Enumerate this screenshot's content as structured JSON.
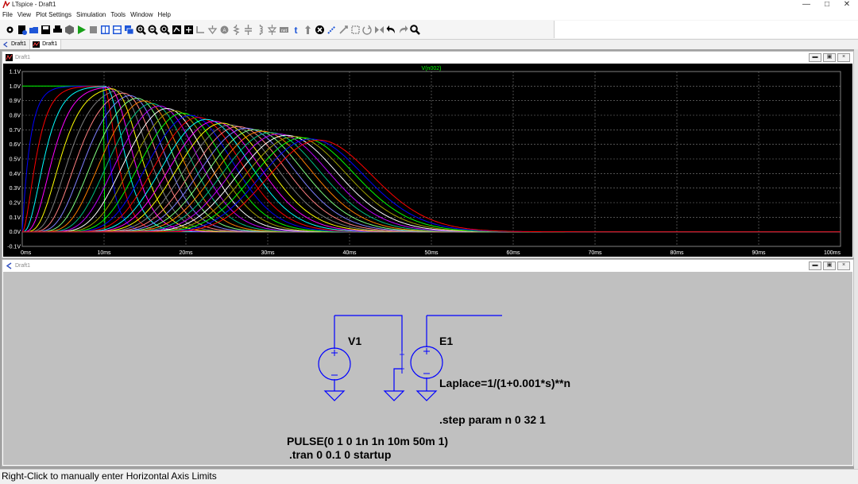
{
  "window": {
    "title": "LTspice - Draft1"
  },
  "menu": [
    "File",
    "View",
    "Plot Settings",
    "Simulation",
    "Tools",
    "Window",
    "Help"
  ],
  "toolbar_icons": [
    "settings-icon",
    "new-schematic-icon",
    "open-icon",
    "save-icon",
    "print-icon",
    "control-panel-icon",
    "run-icon",
    "halt-icon",
    "tile-horizontal-icon",
    "tile-vertical-icon",
    "cascade-icon",
    "zoom-in-icon",
    "zoom-out-icon",
    "zoom-full-icon",
    "autorange-icon",
    "pan-icon",
    "wire-icon",
    "ground-icon",
    "label-icon",
    "resistor-icon",
    "capacitor-icon",
    "inductor-icon",
    "diode-icon",
    "component-icon",
    "text-icon",
    "spice-directive-icon",
    "delete-icon",
    "duplicate-icon",
    "move-icon",
    "drag-icon",
    "rotate-icon",
    "mirror-icon",
    "undo-icon",
    "redo-icon",
    "find-icon"
  ],
  "tabs": [
    {
      "label": "Draft1",
      "kind": "schematic"
    },
    {
      "label": "Draft1",
      "kind": "waveform"
    }
  ],
  "waveform_window": {
    "title": "Draft1",
    "trace_label": "V(n002)"
  },
  "schematic_window": {
    "title": "Draft1",
    "v1_label": "V1",
    "e1_label": "E1",
    "laplace": "Laplace=1/(1+0.001*s)**n",
    "step": ".step param n 0 32 1",
    "pulse": "PULSE(0 1 0 1n 1n 10m 50m 1)",
    "tran": ".tran 0 0.1 0 startup"
  },
  "status": {
    "text": "Right-Click to manually enter Horizontal Axis Limits"
  },
  "colors": {
    "plot_bg": "#000000",
    "grid": "#808080",
    "axis_text": "#ffffff",
    "trace_label": "#00ff00",
    "schematic_bg": "#c0c0c0",
    "wire": "#0000ff",
    "component": "#0000ff",
    "trace_palette": [
      "#00ff00",
      "#0000ff",
      "#ff0000",
      "#00ffff",
      "#ff00ff",
      "#ffff00",
      "#808080",
      "#ff8080",
      "#8080ff",
      "#80ff80",
      "#ff8000",
      "#00c080",
      "#c000ff",
      "#ffffff",
      "#a0a000"
    ]
  },
  "chart_data": {
    "type": "line",
    "title": "V(n002)",
    "xlabel": "",
    "ylabel": "",
    "x_ticks": [
      "0ms",
      "10ms",
      "20ms",
      "30ms",
      "40ms",
      "50ms",
      "60ms",
      "70ms",
      "80ms",
      "90ms",
      "100ms"
    ],
    "y_ticks": [
      "-0.1V",
      "0.0V",
      "0.1V",
      "0.2V",
      "0.3V",
      "0.4V",
      "0.5V",
      "0.6V",
      "0.7V",
      "0.8V",
      "0.9V",
      "1.0V",
      "1.1V"
    ],
    "xlim": [
      0,
      100
    ],
    "ylim": [
      -0.1,
      1.1
    ],
    "grid": true,
    "series_count": 33,
    "tau_ms": 1,
    "pulse_width_ms": 10,
    "step_param": {
      "name": "n",
      "start": 0,
      "stop": 32,
      "step": 1
    }
  }
}
